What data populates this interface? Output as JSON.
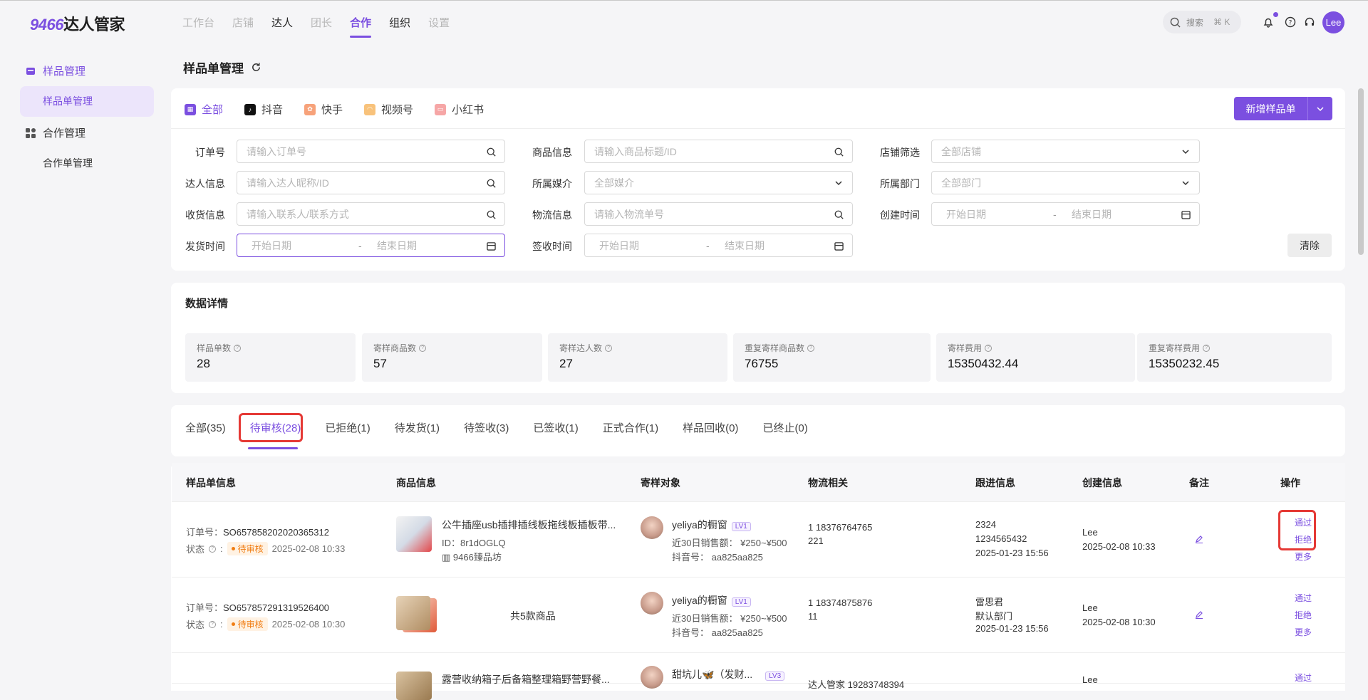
{
  "app": {
    "logo_num": "9466",
    "logo_text": "达人管家"
  },
  "nav": [
    {
      "label": "工作台",
      "style": "muted"
    },
    {
      "label": "店铺",
      "style": "muted"
    },
    {
      "label": "达人",
      "style": "dark"
    },
    {
      "label": "团长",
      "style": "muted"
    },
    {
      "label": "合作",
      "style": "active"
    },
    {
      "label": "组织",
      "style": "dark"
    },
    {
      "label": "设置",
      "style": "muted"
    }
  ],
  "topbar": {
    "search_label": "搜索",
    "search_kbd": "⌘ K",
    "user": "Lee",
    "accent": "#7b4fe0"
  },
  "sidebar": {
    "group1": "样品管理",
    "item1": "样品单管理",
    "group2": "合作管理",
    "item2": "合作单管理"
  },
  "page_title": "样品单管理",
  "platform_tabs": [
    {
      "label": "全部",
      "active": true,
      "icon": "grid-icon"
    },
    {
      "label": "抖音",
      "active": false,
      "icon": "douyin-icon"
    },
    {
      "label": "快手",
      "active": false,
      "icon": "kuaishou-icon"
    },
    {
      "label": "视频号",
      "active": false,
      "icon": "channels-icon"
    },
    {
      "label": "小红书",
      "active": false,
      "icon": "xiaohongshu-icon"
    }
  ],
  "new_button": "新增样品单",
  "filters": {
    "order_no": {
      "label": "订单号",
      "placeholder": "请输入订单号"
    },
    "product": {
      "label": "商品信息",
      "placeholder": "请输入商品标题/ID"
    },
    "shop": {
      "label": "店铺筛选",
      "value": "全部店铺"
    },
    "kol": {
      "label": "达人信息",
      "placeholder": "请输入达人昵称/ID"
    },
    "media": {
      "label": "所属媒介",
      "value": "全部媒介"
    },
    "dept": {
      "label": "所属部门",
      "value": "全部部门"
    },
    "receiver": {
      "label": "收货信息",
      "placeholder": "请输入联系人/联系方式"
    },
    "logistics": {
      "label": "物流信息",
      "placeholder": "请输入物流单号"
    },
    "created": {
      "label": "创建时间",
      "start": "开始日期",
      "end": "结束日期"
    },
    "shipped": {
      "label": "发货时间",
      "start": "开始日期",
      "end": "结束日期"
    },
    "signed": {
      "label": "签收时间",
      "start": "开始日期",
      "end": "结束日期"
    },
    "sep": "-",
    "clear": "清除"
  },
  "stats_title": "数据详情",
  "stats": [
    {
      "label": "样品单数",
      "value": "28"
    },
    {
      "label": "寄样商品数",
      "value": "57"
    },
    {
      "label": "寄样达人数",
      "value": "27"
    },
    {
      "label": "重复寄样商品数",
      "value": "76755"
    },
    {
      "label": "寄样费用",
      "value": "15350432.44"
    },
    {
      "label": "重复寄样费用",
      "value": "15350232.45"
    }
  ],
  "status_tabs": [
    {
      "label": "全部(35)"
    },
    {
      "label": "待审核(28)"
    },
    {
      "label": "已拒绝(1)"
    },
    {
      "label": "待发货(1)"
    },
    {
      "label": "待签收(3)"
    },
    {
      "label": "已签收(1)"
    },
    {
      "label": "正式合作(1)"
    },
    {
      "label": "样品回收(0)"
    },
    {
      "label": "已终止(0)"
    }
  ],
  "table": {
    "headers": [
      "样品单信息",
      "商品信息",
      "寄样对象",
      "物流相关",
      "跟进信息",
      "创建信息",
      "备注",
      "操作"
    ],
    "rows": [
      {
        "order_label": "订单号：",
        "order_no": "SO657858202020365312",
        "status_label": "状态",
        "status": "待审核",
        "status_time": "2025-02-08 10:33",
        "product_title": "公牛插座usb插排插线板拖线板插板带...",
        "product_id": "ID：8r1dOGLQ",
        "shop": "9466臻品坊",
        "kol": "yeliya的橱窗",
        "kol_lv": "LV1",
        "kol_sales": "近30日销售额：  ¥250~¥500",
        "kol_id": "抖音号：  aa825aa825",
        "log1": "1  18376764765",
        "log2": "221",
        "follow1": "2324",
        "follow2": "1234565432",
        "follow3": "2025-01-23 15:56",
        "creator": "Lee",
        "created": "2025-02-08 10:33",
        "op1": "通过",
        "op2": "拒绝",
        "op3": "更多"
      },
      {
        "order_label": "订单号：",
        "order_no": "SO657857291319526400",
        "status_label": "状态",
        "status": "待审核",
        "status_time": "2025-02-08 10:30",
        "product_count": "共5款商品",
        "kol": "yeliya的橱窗",
        "kol_lv": "LV1",
        "kol_sales": "近30日销售额：  ¥250~¥500",
        "kol_id": "抖音号：  aa825aa825",
        "log1": "1  18374875876",
        "log2": "11",
        "follow1": "雷思君",
        "follow2": "默认部门",
        "follow3": "2025-01-23 15:56",
        "creator": "Lee",
        "created": "2025-02-08 10:30",
        "op1": "通过",
        "op2": "拒绝",
        "op3": "更多"
      },
      {
        "product_title": "露营收纳箱子后备箱整理箱野营野餐...",
        "kol": "甜坑儿🦋（发财...",
        "kol_lv": "LV3",
        "log1": "达人管家  19283748394",
        "creator": "Lee",
        "op1": "通过"
      }
    ]
  }
}
